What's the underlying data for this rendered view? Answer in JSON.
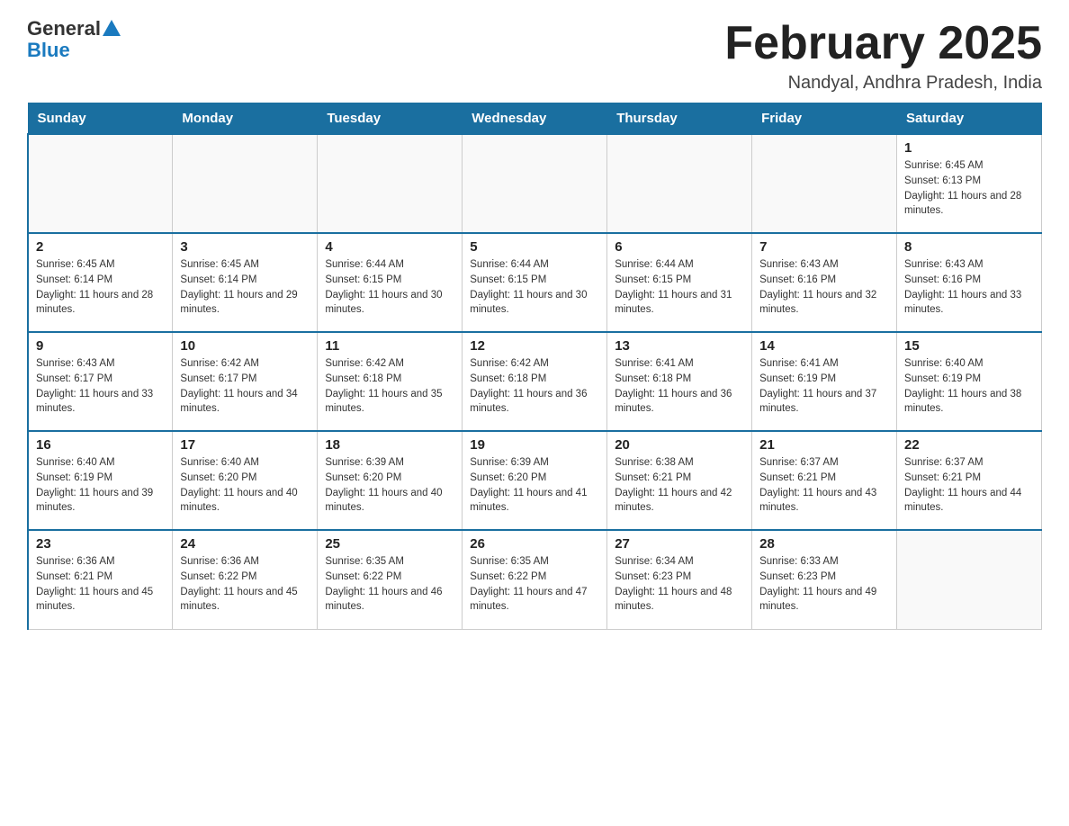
{
  "header": {
    "logo_general": "General",
    "logo_blue": "Blue",
    "title": "February 2025",
    "subtitle": "Nandyal, Andhra Pradesh, India"
  },
  "weekdays": [
    "Sunday",
    "Monday",
    "Tuesday",
    "Wednesday",
    "Thursday",
    "Friday",
    "Saturday"
  ],
  "weeks": [
    [
      {
        "day": "",
        "sunrise": "",
        "sunset": "",
        "daylight": ""
      },
      {
        "day": "",
        "sunrise": "",
        "sunset": "",
        "daylight": ""
      },
      {
        "day": "",
        "sunrise": "",
        "sunset": "",
        "daylight": ""
      },
      {
        "day": "",
        "sunrise": "",
        "sunset": "",
        "daylight": ""
      },
      {
        "day": "",
        "sunrise": "",
        "sunset": "",
        "daylight": ""
      },
      {
        "day": "",
        "sunrise": "",
        "sunset": "",
        "daylight": ""
      },
      {
        "day": "1",
        "sunrise": "Sunrise: 6:45 AM",
        "sunset": "Sunset: 6:13 PM",
        "daylight": "Daylight: 11 hours and 28 minutes."
      }
    ],
    [
      {
        "day": "2",
        "sunrise": "Sunrise: 6:45 AM",
        "sunset": "Sunset: 6:14 PM",
        "daylight": "Daylight: 11 hours and 28 minutes."
      },
      {
        "day": "3",
        "sunrise": "Sunrise: 6:45 AM",
        "sunset": "Sunset: 6:14 PM",
        "daylight": "Daylight: 11 hours and 29 minutes."
      },
      {
        "day": "4",
        "sunrise": "Sunrise: 6:44 AM",
        "sunset": "Sunset: 6:15 PM",
        "daylight": "Daylight: 11 hours and 30 minutes."
      },
      {
        "day": "5",
        "sunrise": "Sunrise: 6:44 AM",
        "sunset": "Sunset: 6:15 PM",
        "daylight": "Daylight: 11 hours and 30 minutes."
      },
      {
        "day": "6",
        "sunrise": "Sunrise: 6:44 AM",
        "sunset": "Sunset: 6:15 PM",
        "daylight": "Daylight: 11 hours and 31 minutes."
      },
      {
        "day": "7",
        "sunrise": "Sunrise: 6:43 AM",
        "sunset": "Sunset: 6:16 PM",
        "daylight": "Daylight: 11 hours and 32 minutes."
      },
      {
        "day": "8",
        "sunrise": "Sunrise: 6:43 AM",
        "sunset": "Sunset: 6:16 PM",
        "daylight": "Daylight: 11 hours and 33 minutes."
      }
    ],
    [
      {
        "day": "9",
        "sunrise": "Sunrise: 6:43 AM",
        "sunset": "Sunset: 6:17 PM",
        "daylight": "Daylight: 11 hours and 33 minutes."
      },
      {
        "day": "10",
        "sunrise": "Sunrise: 6:42 AM",
        "sunset": "Sunset: 6:17 PM",
        "daylight": "Daylight: 11 hours and 34 minutes."
      },
      {
        "day": "11",
        "sunrise": "Sunrise: 6:42 AM",
        "sunset": "Sunset: 6:18 PM",
        "daylight": "Daylight: 11 hours and 35 minutes."
      },
      {
        "day": "12",
        "sunrise": "Sunrise: 6:42 AM",
        "sunset": "Sunset: 6:18 PM",
        "daylight": "Daylight: 11 hours and 36 minutes."
      },
      {
        "day": "13",
        "sunrise": "Sunrise: 6:41 AM",
        "sunset": "Sunset: 6:18 PM",
        "daylight": "Daylight: 11 hours and 36 minutes."
      },
      {
        "day": "14",
        "sunrise": "Sunrise: 6:41 AM",
        "sunset": "Sunset: 6:19 PM",
        "daylight": "Daylight: 11 hours and 37 minutes."
      },
      {
        "day": "15",
        "sunrise": "Sunrise: 6:40 AM",
        "sunset": "Sunset: 6:19 PM",
        "daylight": "Daylight: 11 hours and 38 minutes."
      }
    ],
    [
      {
        "day": "16",
        "sunrise": "Sunrise: 6:40 AM",
        "sunset": "Sunset: 6:19 PM",
        "daylight": "Daylight: 11 hours and 39 minutes."
      },
      {
        "day": "17",
        "sunrise": "Sunrise: 6:40 AM",
        "sunset": "Sunset: 6:20 PM",
        "daylight": "Daylight: 11 hours and 40 minutes."
      },
      {
        "day": "18",
        "sunrise": "Sunrise: 6:39 AM",
        "sunset": "Sunset: 6:20 PM",
        "daylight": "Daylight: 11 hours and 40 minutes."
      },
      {
        "day": "19",
        "sunrise": "Sunrise: 6:39 AM",
        "sunset": "Sunset: 6:20 PM",
        "daylight": "Daylight: 11 hours and 41 minutes."
      },
      {
        "day": "20",
        "sunrise": "Sunrise: 6:38 AM",
        "sunset": "Sunset: 6:21 PM",
        "daylight": "Daylight: 11 hours and 42 minutes."
      },
      {
        "day": "21",
        "sunrise": "Sunrise: 6:37 AM",
        "sunset": "Sunset: 6:21 PM",
        "daylight": "Daylight: 11 hours and 43 minutes."
      },
      {
        "day": "22",
        "sunrise": "Sunrise: 6:37 AM",
        "sunset": "Sunset: 6:21 PM",
        "daylight": "Daylight: 11 hours and 44 minutes."
      }
    ],
    [
      {
        "day": "23",
        "sunrise": "Sunrise: 6:36 AM",
        "sunset": "Sunset: 6:21 PM",
        "daylight": "Daylight: 11 hours and 45 minutes."
      },
      {
        "day": "24",
        "sunrise": "Sunrise: 6:36 AM",
        "sunset": "Sunset: 6:22 PM",
        "daylight": "Daylight: 11 hours and 45 minutes."
      },
      {
        "day": "25",
        "sunrise": "Sunrise: 6:35 AM",
        "sunset": "Sunset: 6:22 PM",
        "daylight": "Daylight: 11 hours and 46 minutes."
      },
      {
        "day": "26",
        "sunrise": "Sunrise: 6:35 AM",
        "sunset": "Sunset: 6:22 PM",
        "daylight": "Daylight: 11 hours and 47 minutes."
      },
      {
        "day": "27",
        "sunrise": "Sunrise: 6:34 AM",
        "sunset": "Sunset: 6:23 PM",
        "daylight": "Daylight: 11 hours and 48 minutes."
      },
      {
        "day": "28",
        "sunrise": "Sunrise: 6:33 AM",
        "sunset": "Sunset: 6:23 PM",
        "daylight": "Daylight: 11 hours and 49 minutes."
      },
      {
        "day": "",
        "sunrise": "",
        "sunset": "",
        "daylight": ""
      }
    ]
  ]
}
